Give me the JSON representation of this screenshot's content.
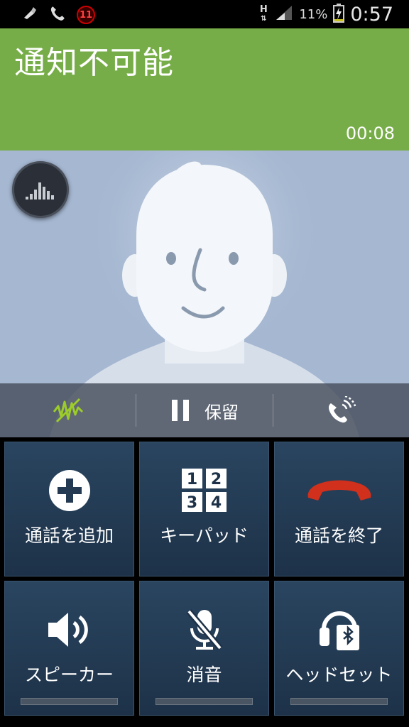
{
  "status_bar": {
    "notification_count": "11",
    "network_type": "H",
    "battery_percent": "11%",
    "time": "0:57"
  },
  "call": {
    "caller_name": "通知不可能",
    "duration": "00:08"
  },
  "toolbar": {
    "hold_label": "保留"
  },
  "actions": [
    {
      "label": "通話を追加",
      "icon": "add-call-icon"
    },
    {
      "label": "キーパッド",
      "icon": "keypad-icon"
    },
    {
      "label": "通話を終了",
      "icon": "end-call-icon"
    },
    {
      "label": "スピーカー",
      "icon": "speaker-icon"
    },
    {
      "label": "消音",
      "icon": "mute-icon"
    },
    {
      "label": "ヘッドセット",
      "icon": "bluetooth-headset-icon"
    }
  ],
  "keypad_digits": [
    "1",
    "2",
    "3",
    "4"
  ],
  "colors": {
    "header_green": "#77ad48",
    "photo_bg": "#a5b7d1",
    "tile_bg": "#243a52",
    "end_call_red": "#d0301c",
    "noise_icon_green": "#9ccc2a"
  }
}
